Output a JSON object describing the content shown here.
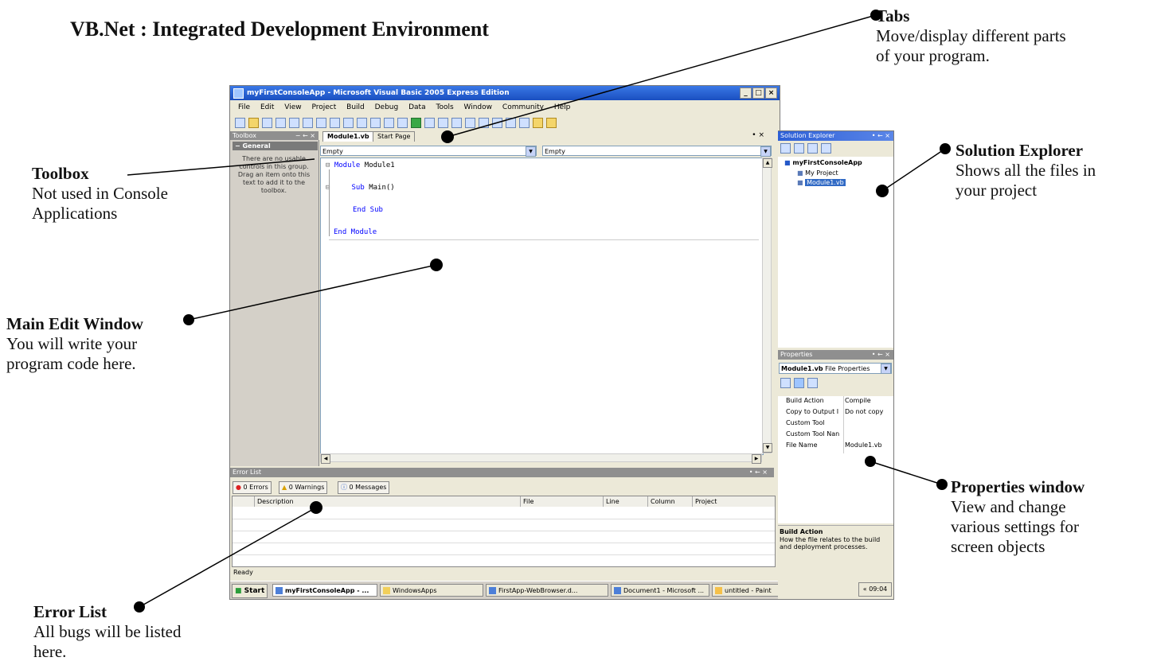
{
  "page_title": "VB.Net : Integrated Development Environment",
  "callouts": {
    "tabs": {
      "heading": "Tabs",
      "text_1": "Move/display different parts",
      "text_2": "of your program."
    },
    "toolbox": {
      "heading": "Toolbox",
      "text_1": "Not used in Console",
      "text_2": "Applications"
    },
    "solution_explorer": {
      "heading": "Solution Explorer",
      "text_1": "Shows all the files in",
      "text_2": "your project"
    },
    "main_edit": {
      "heading": "Main Edit Window",
      "text_1": "You will write your",
      "text_2": "program code here."
    },
    "properties": {
      "heading": "Properties window",
      "text_1": "View and change",
      "text_2": "various settings for",
      "text_3": "screen objects"
    },
    "error_list": {
      "heading": "Error List",
      "text_1": "All bugs will be listed",
      "text_2": "here."
    }
  },
  "ide": {
    "window_title": "myFirstConsoleApp - Microsoft Visual Basic 2005 Express Edition",
    "window_buttons": [
      "_",
      "□",
      "×"
    ],
    "menu": [
      "File",
      "Edit",
      "View",
      "Project",
      "Build",
      "Debug",
      "Data",
      "Tools",
      "Window",
      "Community",
      "Help"
    ],
    "toolbox": {
      "title": "Toolbox",
      "pin": "− ← ×",
      "group": "− General",
      "message": "There are no usable controls in this group. Drag an item onto this text to add it to the toolbox."
    },
    "tabs": [
      "Module1.vb",
      "Start Page"
    ],
    "tab_close": "• ×",
    "dropdown_left": "Empty",
    "dropdown_right": "Empty",
    "code": {
      "l1_kw": "Module",
      "l1_rest": " Module1",
      "l2_kw": "Sub",
      "l2_rest": " Main()",
      "l3": "End Sub",
      "l4": "End Module"
    },
    "solution_explorer": {
      "title": "Solution Explorer",
      "controls": "• ← ×",
      "root": "myFirstConsoleApp",
      "items": [
        "My Project",
        "Module1.vb"
      ]
    },
    "properties": {
      "title": "Properties",
      "controls": "• ← ×",
      "object_name": "Module1.vb",
      "object_type": "File Properties",
      "rows": [
        {
          "name": "Build Action",
          "value": "Compile"
        },
        {
          "name": "Copy to Output I",
          "value": "Do not copy"
        },
        {
          "name": "Custom Tool",
          "value": ""
        },
        {
          "name": "Custom Tool Nan",
          "value": ""
        },
        {
          "name": "File Name",
          "value": "Module1.vb"
        }
      ],
      "desc_title": "Build Action",
      "desc_text": "How the file relates to the build and deployment processes."
    },
    "error_list": {
      "title": "Error List",
      "controls": "• ← ×",
      "errors_btn": "0 Errors",
      "warnings_btn": "0 Warnings",
      "messages_btn": "0 Messages",
      "columns": [
        "Description",
        "File",
        "Line",
        "Column",
        "Project"
      ]
    },
    "status": "Ready",
    "taskbar": {
      "start": "Start",
      "tasks": [
        "myFirstConsoleApp - ...",
        "WindowsApps",
        "FirstApp-WebBrowser.d...",
        "Document1 - Microsoft ...",
        "untitled - Paint"
      ],
      "clock": "« 09:04"
    }
  }
}
